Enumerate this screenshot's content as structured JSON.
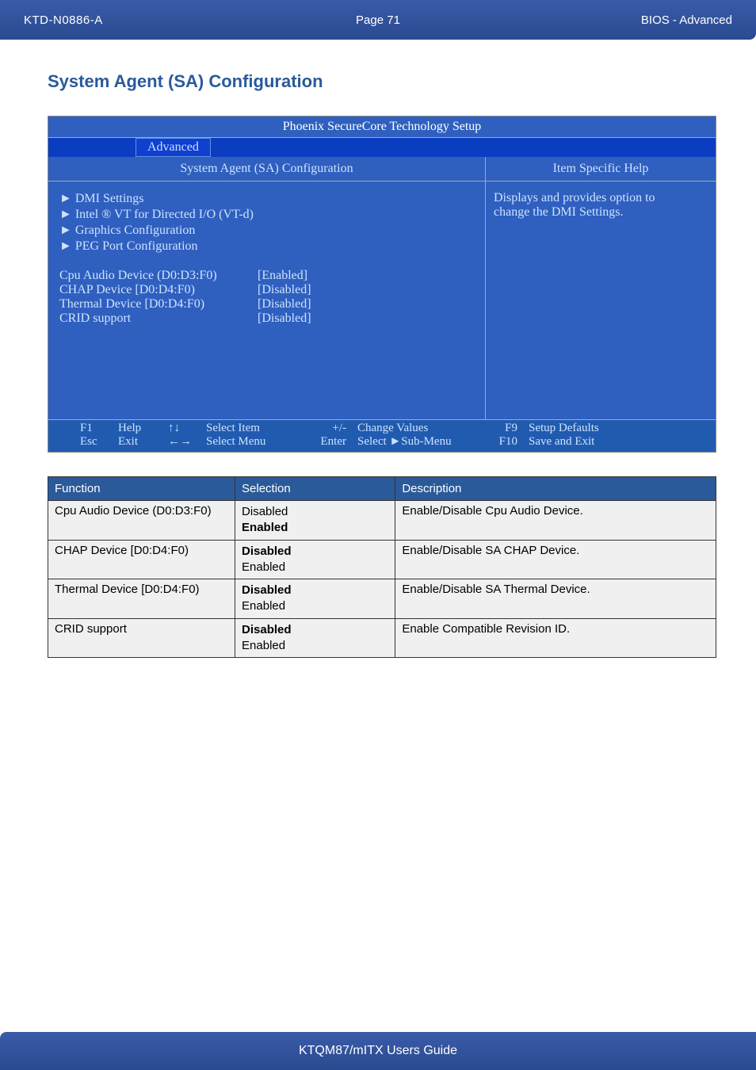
{
  "header": {
    "doc_id": "KTD-N0886-A",
    "page_label": "Page 71",
    "section": "BIOS  - Advanced"
  },
  "heading": "System Agent (SA) Configuration",
  "bios": {
    "title": "Phoenix SecureCore Technology Setup",
    "active_tab": "Advanced",
    "left_header": "System Agent (SA) Configuration",
    "right_header": "Item Specific Help",
    "help_text_line1": "Displays and provides option to",
    "help_text_line2": "change the DMI Settings.",
    "menu_items": [
      "DMI Settings",
      "Intel ® VT for Directed I/O (VT-d)",
      "Graphics Configuration",
      "PEG Port Configuration"
    ],
    "settings": [
      {
        "label": "Cpu Audio Device (D0:D3:F0)",
        "value": "[Enabled]"
      },
      {
        "label": "CHAP Device [D0:D4:F0)",
        "value": "[Disabled]"
      },
      {
        "label": "Thermal Device [D0:D4:F0)",
        "value": "[Disabled]"
      },
      {
        "label": "CRID support",
        "value": "[Disabled]"
      }
    ],
    "footer": {
      "row1": {
        "k": "F1",
        "lbl": "Help",
        "arrow": "↑↓",
        "act": "Select Item",
        "k2": "+/-",
        "act2": "Change Values",
        "k3": "F9",
        "act3": "Setup Defaults"
      },
      "row2": {
        "k": "Esc",
        "lbl": "Exit",
        "arrow": "←→",
        "act": "Select Menu",
        "k2": "Enter",
        "act2": "Select ►Sub-Menu",
        "k3": "F10",
        "act3": "Save and Exit"
      }
    }
  },
  "table": {
    "headers": [
      "Function",
      "Selection",
      "Description"
    ],
    "rows": [
      {
        "func": "Cpu Audio Device (D0:D3:F0)",
        "sel_plain": "Disabled",
        "sel_bold": "Enabled",
        "desc": "Enable/Disable Cpu Audio Device."
      },
      {
        "func": "CHAP Device [D0:D4:F0)",
        "sel_bold": "Disabled",
        "sel_plain": "Enabled",
        "desc": "Enable/Disable SA CHAP Device."
      },
      {
        "func": "Thermal Device [D0:D4:F0)",
        "sel_bold": "Disabled",
        "sel_plain": "Enabled",
        "desc": "Enable/Disable SA Thermal Device."
      },
      {
        "func": "CRID support",
        "sel_bold": "Disabled",
        "sel_plain": "Enabled",
        "desc": "Enable Compatible Revision ID."
      }
    ]
  },
  "footer": "KTQM87/mITX Users Guide"
}
